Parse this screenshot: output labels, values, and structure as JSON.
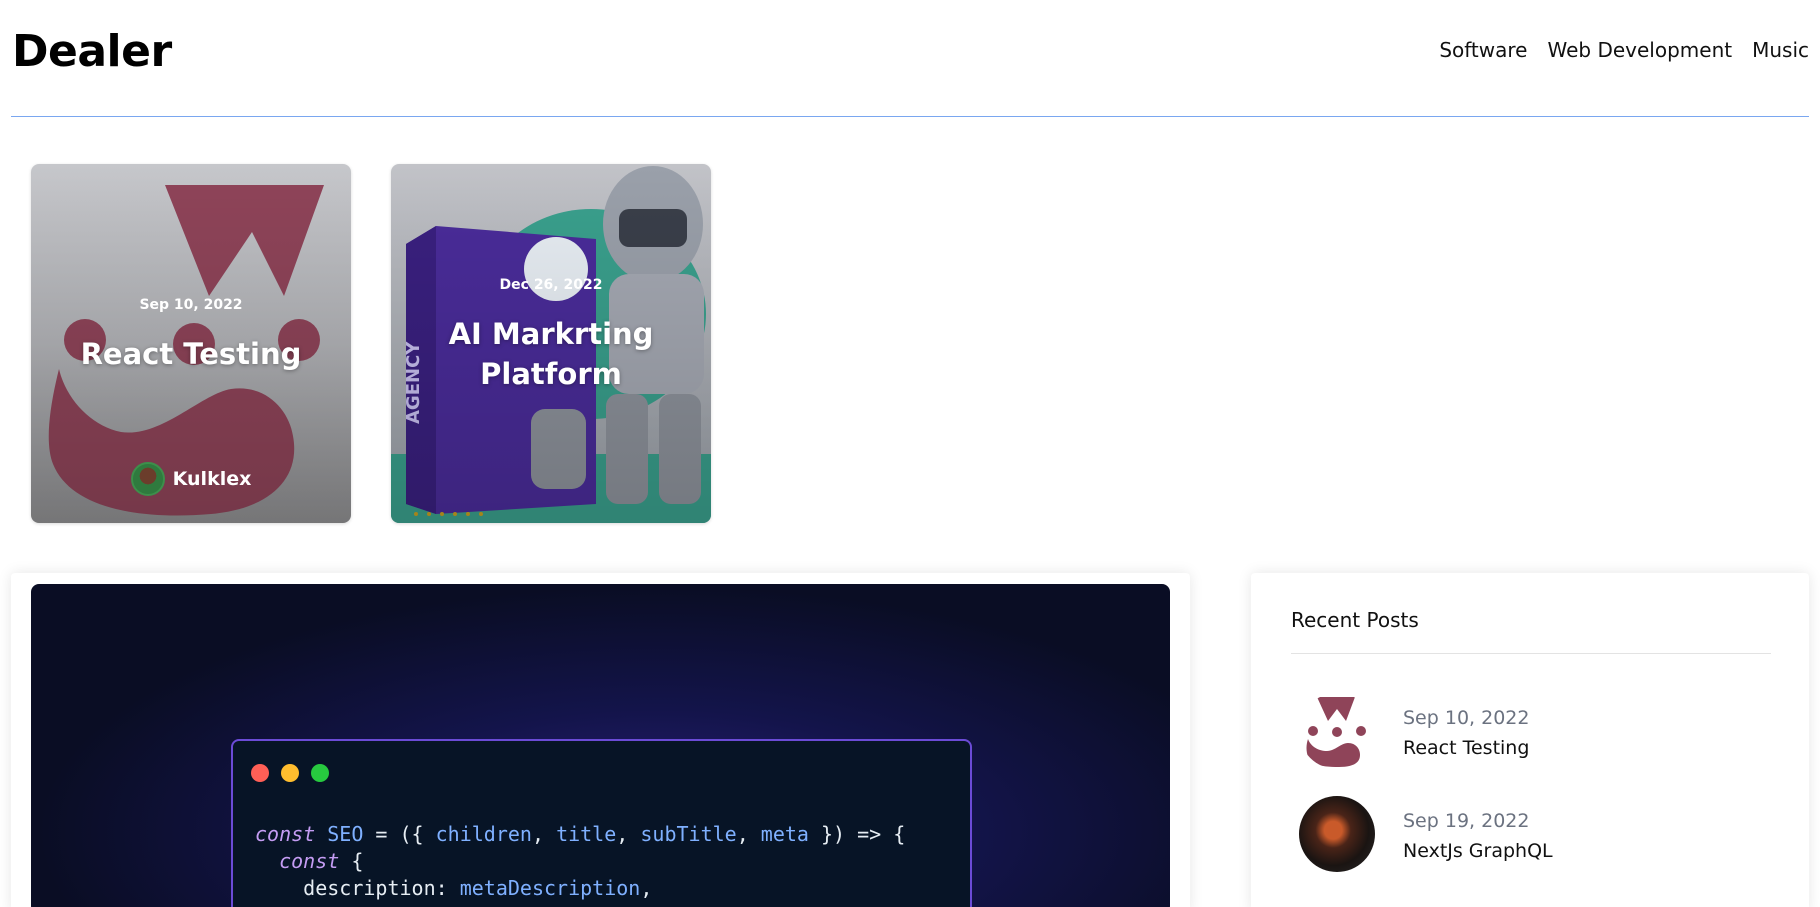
{
  "brand": "Dealer",
  "nav": [
    "Software",
    "Web Development",
    "Music"
  ],
  "cards": [
    {
      "date": "Sep 10, 2022",
      "title": "React Testing",
      "author": "Kulklex"
    },
    {
      "date": "Dec 26, 2022",
      "title_line1": "AI Markrting",
      "title_line2": "Platform"
    }
  ],
  "code": {
    "line1": [
      "const",
      " ",
      "SEO",
      " = ({ ",
      "children",
      ", ",
      "title",
      ", ",
      "subTitle",
      ", ",
      "meta",
      " }) => {"
    ],
    "line2_kw": "const",
    "line2_rest": " {",
    "line3_key": "description: ",
    "line3_val": "metaDescription",
    "line3_end": ","
  },
  "sidebar": {
    "title": "Recent Posts",
    "posts": [
      {
        "date": "Sep 10, 2022",
        "title": "React Testing"
      },
      {
        "date": "Sep 19, 2022",
        "title": "NextJs GraphQL"
      }
    ]
  },
  "colors": {
    "divider": "#7aa7f0",
    "accent": "#6b4bd6",
    "jest": "#8f4459"
  }
}
